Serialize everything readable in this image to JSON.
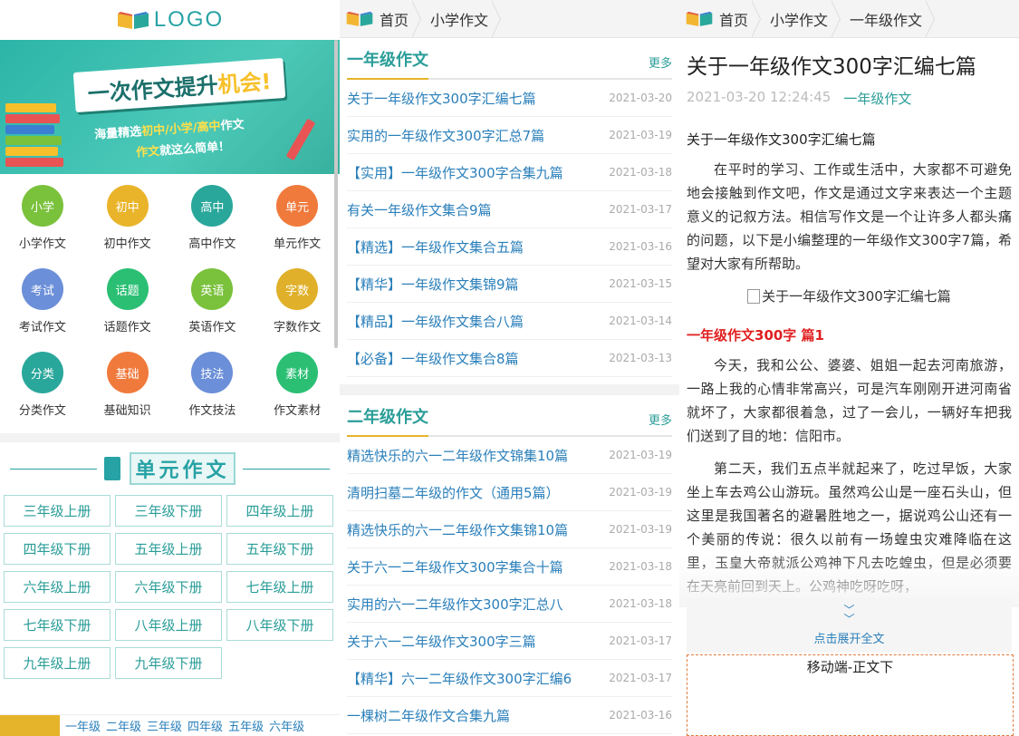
{
  "home": {
    "logo_text": "LOGO",
    "banner": {
      "headline": "一次作文提升",
      "headline_accent": "机会!",
      "line1_prefix": "海量精选",
      "line1_accent": "初中/小学/高中",
      "line1_suffix": "作文",
      "line2_prefix": "作文",
      "line2_accent": "就这么简单！"
    },
    "categories": [
      {
        "short": "小学",
        "label": "小学作文",
        "color": "#7ac13c"
      },
      {
        "short": "初中",
        "label": "初中作文",
        "color": "#e9b42a"
      },
      {
        "short": "高中",
        "label": "高中作文",
        "color": "#2aa79b"
      },
      {
        "short": "单元",
        "label": "单元作文",
        "color": "#f07a3c"
      },
      {
        "short": "考试",
        "label": "考试作文",
        "color": "#6b8fd8"
      },
      {
        "short": "话题",
        "label": "话题作文",
        "color": "#2bbf74"
      },
      {
        "short": "英语",
        "label": "英语作文",
        "color": "#7ac13c"
      },
      {
        "short": "字数",
        "label": "字数作文",
        "color": "#e0b02a"
      },
      {
        "short": "分类",
        "label": "分类作文",
        "color": "#2aa79b"
      },
      {
        "short": "基础",
        "label": "基础知识",
        "color": "#f07a3c"
      },
      {
        "short": "技法",
        "label": "作文技法",
        "color": "#6b8fd8"
      },
      {
        "short": "素材",
        "label": "作文素材",
        "color": "#2bbf74"
      }
    ],
    "unit_title": "单元作文",
    "grades": [
      "三年级上册",
      "三年级下册",
      "四年级上册",
      "四年级下册",
      "五年级上册",
      "五年级下册",
      "六年级上册",
      "六年级下册",
      "七年级上册",
      "七年级下册",
      "八年级上册",
      "八年级下册",
      "九年级上册",
      "九年级下册"
    ],
    "bottom_tabs": [
      "一年级",
      "二年级",
      "三年级",
      "四年级",
      "五年级",
      "六年级"
    ]
  },
  "list_page": {
    "breadcrumb": [
      "首页",
      "小学作文"
    ],
    "more_label": "更多",
    "sections": [
      {
        "title": "一年级作文",
        "items": [
          {
            "title": "关于一年级作文300字汇编七篇",
            "date": "2021-03-20"
          },
          {
            "title": "实用的一年级作文300字汇总7篇",
            "date": "2021-03-19"
          },
          {
            "title": "【实用】一年级作文300字合集九篇",
            "date": "2021-03-18"
          },
          {
            "title": "有关一年级作文集合9篇",
            "date": "2021-03-17"
          },
          {
            "title": "【精选】一年级作文集合五篇",
            "date": "2021-03-16"
          },
          {
            "title": "【精华】一年级作文集锦9篇",
            "date": "2021-03-15"
          },
          {
            "title": "【精品】一年级作文集合八篇",
            "date": "2021-03-14"
          },
          {
            "title": "【必备】一年级作文集合8篇",
            "date": "2021-03-13"
          }
        ]
      },
      {
        "title": "二年级作文",
        "items": [
          {
            "title": "精选快乐的六一二年级作文锦集10篇",
            "date": "2021-03-19"
          },
          {
            "title": "清明扫墓二年级的作文（通用5篇）",
            "date": "2021-03-19"
          },
          {
            "title": "精选快乐的六一二年级作文集锦10篇",
            "date": "2021-03-19"
          },
          {
            "title": "关于六一二年级作文300字集合十篇",
            "date": "2021-03-18"
          },
          {
            "title": "实用的六一二年级作文300字汇总八",
            "date": "2021-03-18"
          },
          {
            "title": "关于六一二年级作文300字三篇",
            "date": "2021-03-17"
          },
          {
            "title": "【精华】六一二年级作文300字汇编6",
            "date": "2021-03-17"
          },
          {
            "title": "一棵树二年级作文合集九篇",
            "date": "2021-03-16"
          }
        ]
      }
    ]
  },
  "article_page": {
    "breadcrumb": [
      "首页",
      "小学作文",
      "一年级作文"
    ],
    "title": "关于一年级作文300字汇编七篇",
    "datetime": "2021-03-20 12:24:45",
    "category": "一年级作文",
    "subtitle": "关于一年级作文300字汇编七篇",
    "intro": "在平时的学习、工作或生活中，大家都不可避免地会接触到作文吧，作文是通过文字来表达一个主题意义的记叙方法。相信写作文是一个让许多人都头痛的问题，以下是小编整理的一年级作文300字7篇，希望对大家有所帮助。",
    "image_alt": "关于一年级作文300字汇编七篇",
    "heading1": "一年级作文300字 篇1",
    "para1": "今天，我和公公、婆婆、姐姐一起去河南旅游，一路上我的心情非常高兴，可是汽车刚刚开进河南省就坏了，大家都很着急，过了一会儿，一辆好车把我们送到了目的地：信阳市。",
    "para2": "第二天，我们五点半就起来了，吃过早饭，大家坐上车去鸡公山游玩。虽然鸡公山是一座石头山，但这里是我国著名的避暑胜地之一，据说鸡公山还有一个美丽的传说：很久以前有一场蝗虫灾难降临在这里，玉皇大帝就派公鸡神下凡去吃蝗虫，但是必须要在天亮前回到天上。公鸡神吃呀吃呀，",
    "expand_label": "点击展开全文",
    "ad_label": "移动端-正文下"
  }
}
